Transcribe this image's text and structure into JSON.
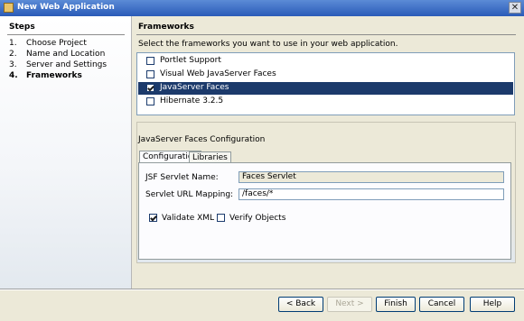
{
  "window": {
    "title": "New Web Application",
    "icon": "java-web-app-icon",
    "close_label": "✕"
  },
  "steps": {
    "title": "Steps",
    "items": [
      {
        "num": "1.",
        "label": "Choose Project",
        "current": false
      },
      {
        "num": "2.",
        "label": "Name and Location",
        "current": false
      },
      {
        "num": "3.",
        "label": "Server and Settings",
        "current": false
      },
      {
        "num": "4.",
        "label": "Frameworks",
        "current": true
      }
    ]
  },
  "frameworks": {
    "title": "Frameworks",
    "description": "Select the frameworks you want to use in your web application.",
    "items": [
      {
        "label": "Portlet Support",
        "checked": false,
        "selected": false
      },
      {
        "label": "Visual Web JavaServer Faces",
        "checked": false,
        "selected": false
      },
      {
        "label": "JavaServer Faces",
        "checked": true,
        "selected": true
      },
      {
        "label": "Hibernate 3.2.5",
        "checked": false,
        "selected": false
      }
    ]
  },
  "config": {
    "title": "JavaServer Faces Configuration",
    "tabs": [
      {
        "label": "Configuration",
        "active": true
      },
      {
        "label": "Libraries",
        "active": false
      }
    ],
    "servlet_name_label": "JSF Servlet Name:",
    "servlet_name_value": "Faces Servlet",
    "url_mapping_label": "Servlet URL Mapping:",
    "url_mapping_value": "/faces/*",
    "validate_xml": {
      "label": "Validate XML",
      "checked": true
    },
    "verify_objects": {
      "label": "Verify Objects",
      "checked": false
    }
  },
  "buttons": {
    "back": "< Back",
    "next": "Next >",
    "finish": "Finish",
    "cancel": "Cancel",
    "help": "Help"
  }
}
